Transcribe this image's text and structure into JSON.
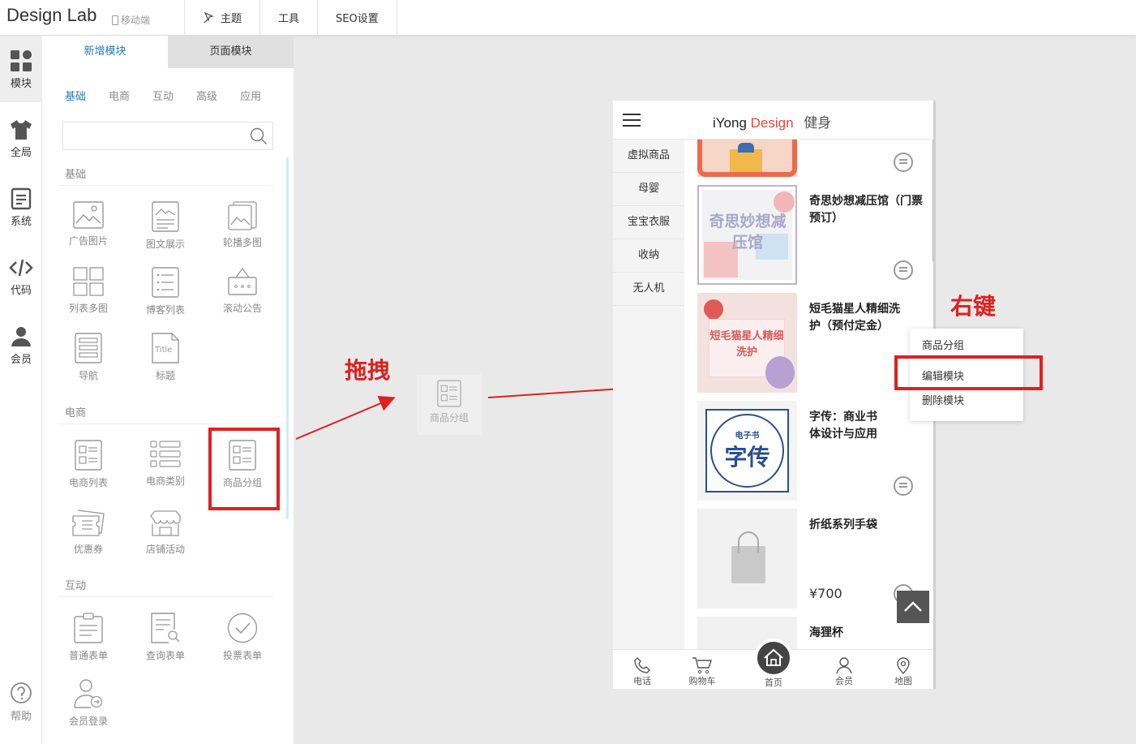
{
  "topbar": {
    "logo": "Design Lab",
    "mobile_label": "移动端",
    "nav": [
      "主题",
      "工具",
      "SEO设置"
    ]
  },
  "sidebar": {
    "items": [
      {
        "label": "模块",
        "icon": "modules-icon"
      },
      {
        "label": "全局",
        "icon": "shirt-icon"
      },
      {
        "label": "系统",
        "icon": "document-icon"
      },
      {
        "label": "代码",
        "icon": "code-icon"
      },
      {
        "label": "会员",
        "icon": "user-icon"
      }
    ],
    "help": "帮助"
  },
  "panel": {
    "tabs": [
      "新增模块",
      "页面模块"
    ],
    "categories": [
      "基础",
      "电商",
      "互动",
      "高级",
      "应用"
    ],
    "search_placeholder": "",
    "sections": [
      {
        "title": "基础",
        "modules": [
          "广告图片",
          "图文展示",
          "轮播多图",
          "列表多图",
          "博客列表",
          "滚动公告",
          "导航",
          "标题"
        ]
      },
      {
        "title": "电商",
        "modules": [
          "电商列表",
          "电商类别",
          "商品分组",
          "优惠券",
          "店铺活动"
        ]
      },
      {
        "title": "互动",
        "modules": [
          "普通表单",
          "查询表单",
          "投票表单",
          "会员登录"
        ]
      }
    ]
  },
  "annotations": {
    "drag": "拖拽",
    "right_click": "右键",
    "drag_ghost_label": "商品分组"
  },
  "phone": {
    "brand_1": "iYong",
    "brand_2": "Design",
    "brand_3": "健身",
    "side": [
      "虚拟商品",
      "母婴",
      "宝宝衣服",
      "收纳",
      "无人机"
    ],
    "products": [
      {
        "name": "奇思妙想减压馆（门票预订）",
        "image_text": "奇思妙想减压馆"
      },
      {
        "name": "短毛猫星人精细洗护（预付定金）",
        "image_text": "短毛猫星人精细洗护"
      },
      {
        "name": "字传：商业书体设计与应用",
        "image_text_small": "电子书",
        "image_text": "字传"
      },
      {
        "name": "折纸系列手袋",
        "price": "¥700"
      },
      {
        "name": "海狸杯"
      }
    ],
    "footer": [
      "电话",
      "购物车",
      "首页",
      "会员",
      "地图"
    ]
  },
  "context_menu": {
    "items": [
      "商品分组",
      "编辑模块",
      "删除模块"
    ]
  },
  "colors": {
    "accent": "#2a7ab5",
    "annotation_red": "#e02020",
    "brand_red": "#e8483b"
  }
}
